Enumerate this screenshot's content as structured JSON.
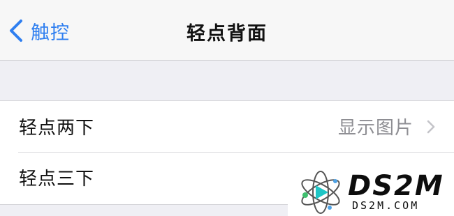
{
  "nav": {
    "back_label": "触控",
    "title": "轻点背面"
  },
  "rows": [
    {
      "label": "轻点两下",
      "value": "显示图片"
    },
    {
      "label": "轻点三下",
      "value": ""
    }
  ],
  "watermark": {
    "brand": "DS2M",
    "domain": "DS2M.COM"
  },
  "colors": {
    "accent": "#2f7ff0",
    "background": "#efeff4",
    "secondary_text": "#8e8e93"
  }
}
